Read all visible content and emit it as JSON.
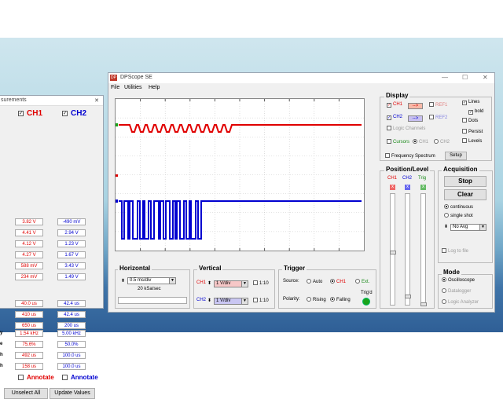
{
  "measurements": {
    "title": "surements",
    "close": "✕",
    "ch1_label": "CH1",
    "ch2_label": "CH2",
    "ch1_color": "#e00000",
    "ch2_color": "#0000d0",
    "rows": [
      {
        "label": "",
        "ch1": "3.82 V",
        "ch2": "-490 mV"
      },
      {
        "label": "",
        "ch1": "4.41 V",
        "ch2": "2.94 V"
      },
      {
        "label": "",
        "ch1": "4.12 V",
        "ch2": "1.23 V"
      },
      {
        "label": "",
        "ch1": "4.27 V",
        "ch2": "1.67 V"
      },
      {
        "label": "",
        "ch1": "588 mV",
        "ch2": "3.43 V"
      },
      {
        "label": "",
        "ch1": "234 mV",
        "ch2": "1.49 V"
      },
      {
        "label": "",
        "ch1": "40.0 us",
        "ch2": "42.4 us"
      },
      {
        "label": "",
        "ch1": "410 us",
        "ch2": "42.4 us"
      },
      {
        "label": "",
        "ch1": "650 us",
        "ch2": "200 us"
      },
      {
        "label": "y",
        "ch1": "1.54 kHz",
        "ch2": "5.00 kHz"
      },
      {
        "label": "e",
        "ch1": "75.6%",
        "ch2": "50.0%"
      },
      {
        "label": "h",
        "ch1": "492 us",
        "ch2": "100.0 us"
      },
      {
        "label": "h",
        "ch1": "158 us",
        "ch2": "100.0 us"
      }
    ],
    "annotate_label": "Annotate",
    "unselect_all": "Unselect All",
    "update_values": "Update Values"
  },
  "dpscope": {
    "title": "DPScope SE",
    "window_controls": [
      "—",
      "☐",
      "✕"
    ],
    "menu": [
      "File",
      "Utilities",
      "Help"
    ],
    "display": {
      "title": "Display",
      "ch1": "CH1",
      "ch2": "CH2",
      "ref1": "REF1",
      "ref2": "REF2",
      "arrow": "-->",
      "logic_channels": "Logic Channels",
      "cursors": "Cursors",
      "c_ch1": "CH1",
      "c_ch2": "CH2",
      "lines": "Lines",
      "bold": "bold",
      "dots": "Dots",
      "persist": "Persist",
      "levels": "Levels",
      "freq_spectrum": "Frequency Spectrum",
      "setup": "Setup"
    },
    "poslevel": {
      "title": "Position/Level",
      "ch1": "CH1",
      "ch2": "CH2",
      "trig": "Trig",
      "x": "x"
    },
    "acquisition": {
      "title": "Acquisition",
      "stop": "Stop",
      "clear": "Clear",
      "continuous": "continuous",
      "single_shot": "single shot",
      "avg": "No Avg",
      "log_to_file": "Log to file"
    },
    "mode": {
      "title": "Mode",
      "oscilloscope": "Oscilloscope",
      "datalogger": "Datalogger",
      "logic_analyzer": "Logic Analyzer"
    },
    "horizontal": {
      "title": "Horizontal",
      "timebase": "0.5 ms/div",
      "sample_rate": "20 kSa/sec"
    },
    "vertical": {
      "title": "Vertical",
      "ch1": "CH1",
      "ch2": "CH2",
      "ch1_scale": "1 V/div",
      "ch2_scale": "1 V/div",
      "x10": "1:10"
    },
    "trigger": {
      "title": "Trigger",
      "source": "Source:",
      "auto": "Auto",
      "ch1": "CH1",
      "ext": "Ext.",
      "polarity": "Polarity:",
      "rising": "Rising",
      "falling": "Falling",
      "trigd": "Trig'd"
    }
  },
  "colors": {
    "ch1": "#e00000",
    "ch2": "#0000d0",
    "trig_led": "#1aa31a"
  }
}
